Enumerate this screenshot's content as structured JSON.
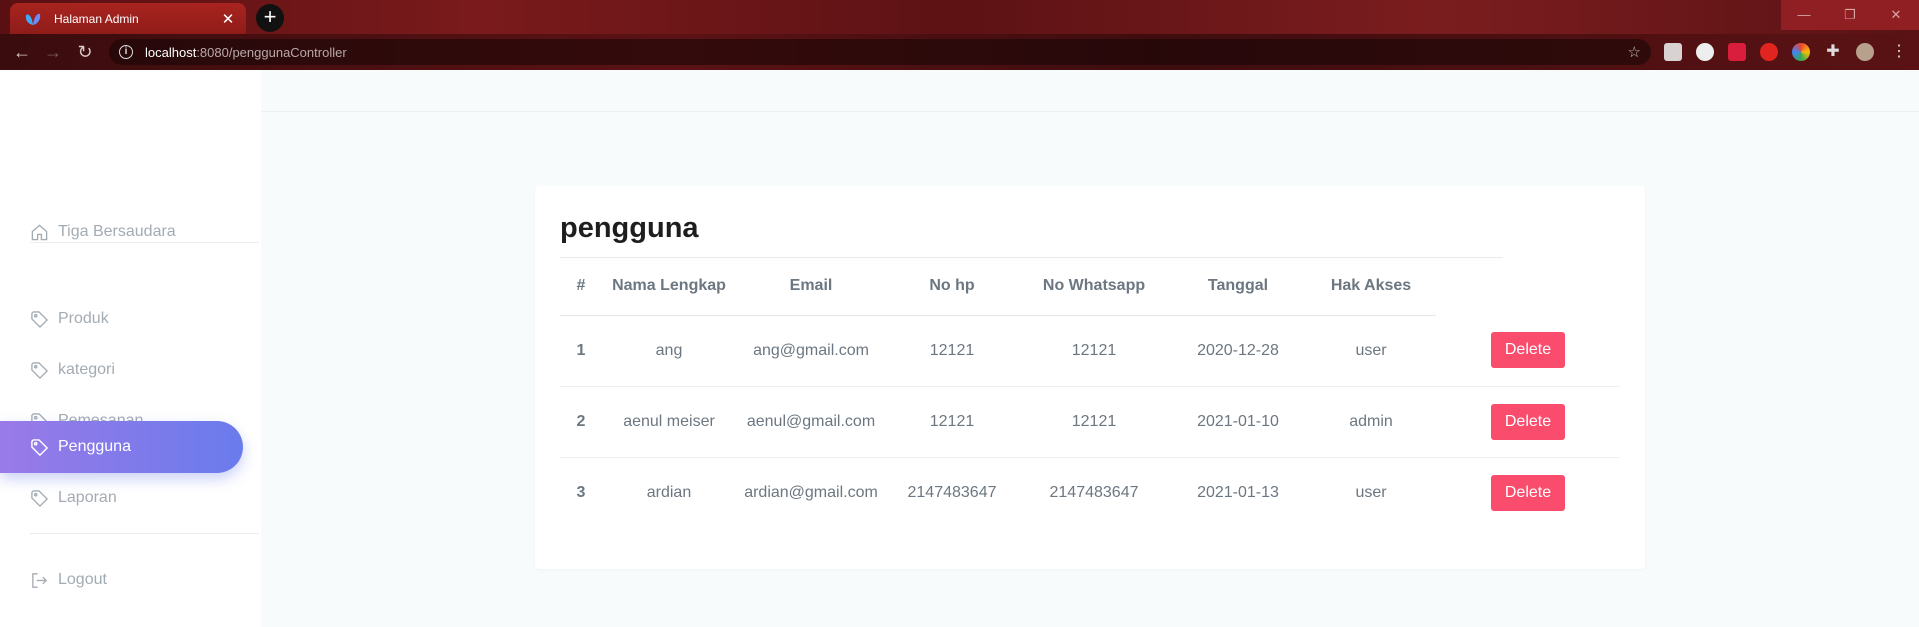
{
  "browser": {
    "tab_title": "Halaman Admin",
    "new_tab_label": "+",
    "url_host": "localhost",
    "url_path": ":8080/penggunaController"
  },
  "sidebar": {
    "brand": "Tiga Bersaudara",
    "items": [
      {
        "label": "Produk",
        "active": false
      },
      {
        "label": "kategori",
        "active": false
      },
      {
        "label": "Pemesanan",
        "active": false
      },
      {
        "label": "Pengguna",
        "active": true
      },
      {
        "label": "Laporan",
        "active": false
      }
    ],
    "logout": "Logout"
  },
  "main": {
    "title": "pengguna",
    "columns": [
      "#",
      "Nama Lengkap",
      "Email",
      "No hp",
      "No Whatsapp",
      "Tanggal",
      "Hak Akses"
    ],
    "rows": [
      {
        "no": "1",
        "nama": "ang",
        "email": "ang@gmail.com",
        "hp": "12121",
        "wa": "12121",
        "tanggal": "2020-12-28",
        "akses": "user"
      },
      {
        "no": "2",
        "nama": "aenul meiser",
        "email": "aenul@gmail.com",
        "hp": "12121",
        "wa": "12121",
        "tanggal": "2021-01-10",
        "akses": "admin"
      },
      {
        "no": "3",
        "nama": "ardian",
        "email": "ardian@gmail.com",
        "hp": "2147483647",
        "wa": "2147483647",
        "tanggal": "2021-01-13",
        "akses": "user"
      }
    ],
    "delete_label": "Delete"
  },
  "colors": {
    "accent_start": "#9a7ae8",
    "accent_end": "#6a7bec",
    "delete": "#fa4d6d",
    "browser_theme": "#7a1a1c"
  },
  "icons": {
    "home": "home-icon",
    "menu_item": "tag-icon",
    "logout": "logout-icon"
  }
}
